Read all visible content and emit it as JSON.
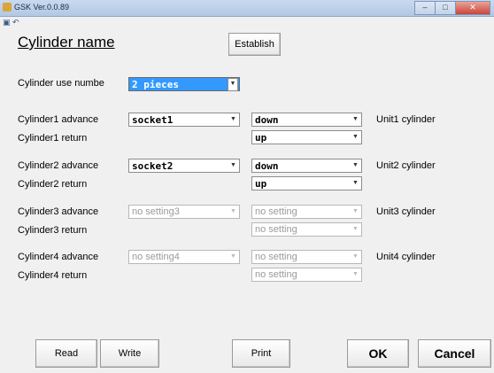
{
  "window": {
    "title": "GSK Ver.0.0.89",
    "controls": [
      "minimize-icon",
      "maximize-icon",
      "close-icon"
    ]
  },
  "page_title": "Cylinder name",
  "establish_label": "Establish",
  "use_number": {
    "label": "Cylinder  use numbe",
    "value": "2 pieces"
  },
  "cylinders": [
    {
      "advance_label": "Cylinder1 advance",
      "return_label": "Cylinder1 return",
      "socket": "socket1",
      "advance_value": "down",
      "return_value": "up",
      "unit_label": "Unit1 cylinder",
      "enabled": true
    },
    {
      "advance_label": "Cylinder2 advance",
      "return_label": "Cylinder2 return",
      "socket": "socket2",
      "advance_value": "down",
      "return_value": "up",
      "unit_label": "Unit2 cylinder",
      "enabled": true
    },
    {
      "advance_label": "Cylinder3 advance",
      "return_label": "Cylinder3 return",
      "socket": "no setting3",
      "advance_value": "no setting",
      "return_value": "no setting",
      "unit_label": "Unit3 cylinder",
      "enabled": false
    },
    {
      "advance_label": "Cylinder4 advance",
      "return_label": "Cylinder4 return",
      "socket": "no setting4",
      "advance_value": "no setting",
      "return_value": "no setting",
      "unit_label": "Unit4 cylinder",
      "enabled": false
    }
  ],
  "buttons": {
    "read": "Read",
    "write": "Write",
    "print": "Print",
    "ok": "OK",
    "cancel": "Cancel"
  }
}
